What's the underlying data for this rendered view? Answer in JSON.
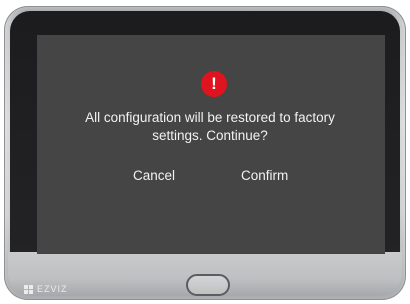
{
  "dialog": {
    "icon": "alert-icon",
    "icon_glyph": "!",
    "message": "All configuration will be restored to factory settings. Continue?",
    "cancel_label": "Cancel",
    "confirm_label": "Confirm"
  },
  "device": {
    "brand": "EZVIZ"
  },
  "colors": {
    "screen_bg": "#454545",
    "alert": "#e0141e",
    "text": "#f2f2f2"
  }
}
